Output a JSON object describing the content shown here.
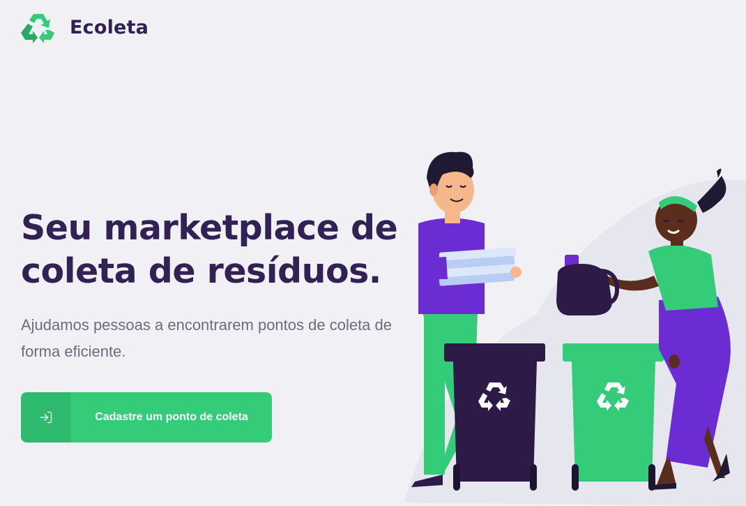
{
  "header": {
    "brand": "Ecoleta",
    "logo_icon": "recycle-icon"
  },
  "hero": {
    "title": "Seu marketplace de coleta de resíduos.",
    "subtitle": "Ajudamos pessoas a encontrarem pontos de coleta de forma eficiente."
  },
  "cta": {
    "label": "Cadastre um ponto de coleta",
    "icon": "log-in-icon"
  },
  "colors": {
    "background": "#F0F0F5",
    "primary_text": "#322153",
    "secondary_text": "#6C6C80",
    "accent_green": "#34CB79",
    "purple": "#6C2CD4",
    "dark_bin": "#2E1A47"
  }
}
